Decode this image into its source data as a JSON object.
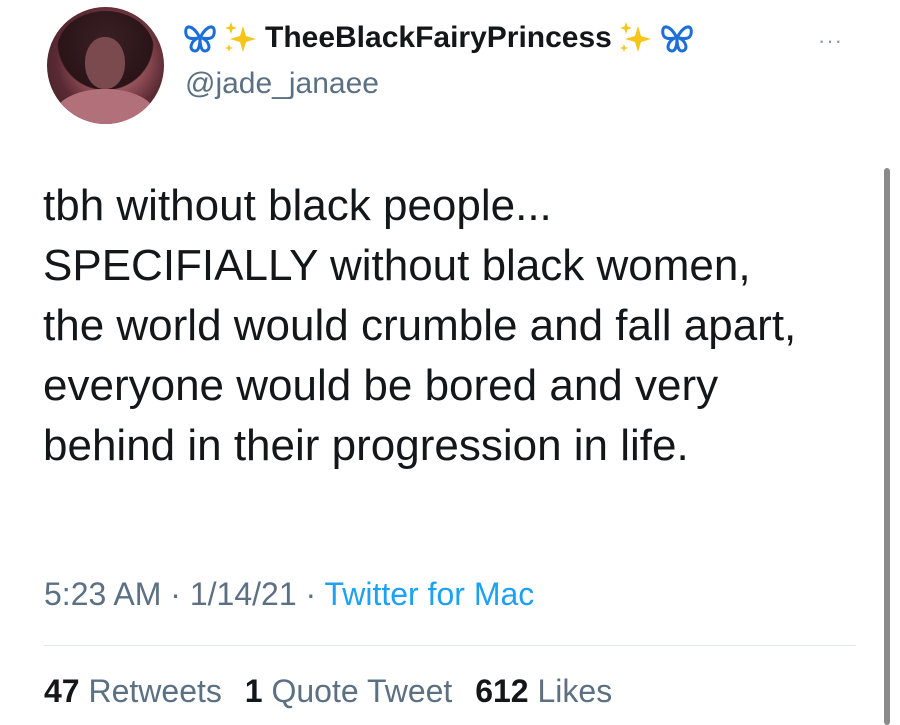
{
  "profile": {
    "display_name": "TheeBlackFairyPrincess",
    "handle": "@jade_janaee",
    "emoji_left": [
      "butterfly",
      "sparkles"
    ],
    "emoji_right": [
      "sparkles",
      "butterfly"
    ]
  },
  "tweet": {
    "lines": [
      "tbh without black people...",
      "SPECIFIALLY without black women,",
      "the world would crumble and fall apart,",
      "everyone would be bored and very",
      "behind in their progression in life."
    ]
  },
  "meta": {
    "time": "5:23 AM",
    "separator": " · ",
    "date": "1/14/21",
    "source": "Twitter for Mac"
  },
  "stats": {
    "retweets_count": "47",
    "retweets_label": "Retweets",
    "quotes_count": "1",
    "quotes_label": "Quote Tweet",
    "likes_count": "612",
    "likes_label": "Likes"
  },
  "more_label": "···",
  "colors": {
    "text": "#14171a",
    "secondary": "#5b7083",
    "link": "#1da1f2",
    "butterfly": "#1d6fd8",
    "sparkle": "#f5c518"
  }
}
